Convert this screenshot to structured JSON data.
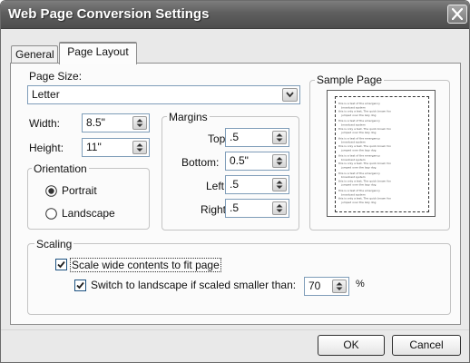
{
  "window": {
    "title": "Web Page Conversion Settings",
    "close_icon": "close-icon"
  },
  "tabs": [
    {
      "label": "General",
      "active": false
    },
    {
      "label": "Page Layout",
      "active": true
    }
  ],
  "page_size": {
    "label": "Page Size:",
    "value": "Letter"
  },
  "dimensions": {
    "width_label": "Width:",
    "width_value": "8.5\"",
    "height_label": "Height:",
    "height_value": "11\""
  },
  "margins": {
    "title": "Margins",
    "top_label": "Top:",
    "top_value": ".5",
    "bottom_label": "Bottom:",
    "bottom_value": "0.5\"",
    "left_label": "Left:",
    "left_value": ".5",
    "right_label": "Right:",
    "right_value": ".5"
  },
  "orientation": {
    "title": "Orientation",
    "portrait_label": "Portrait",
    "landscape_label": "Landscape",
    "selected": "Portrait"
  },
  "sample_page": {
    "title": "Sample Page",
    "lines": [
      "this is a test of the emergency",
      "broadcast system",
      "this is only a test. The quick brown fox",
      "jumped over the lazy dog"
    ]
  },
  "scaling": {
    "title": "Scaling",
    "scale_wide_label": "Scale wide contents to fit page",
    "scale_wide_checked": true,
    "switch_label": "Switch to landscape if scaled smaller than:",
    "switch_checked": true,
    "threshold_value": "70",
    "threshold_unit": "%"
  },
  "buttons": {
    "ok_label": "OK",
    "cancel_label": "Cancel"
  }
}
